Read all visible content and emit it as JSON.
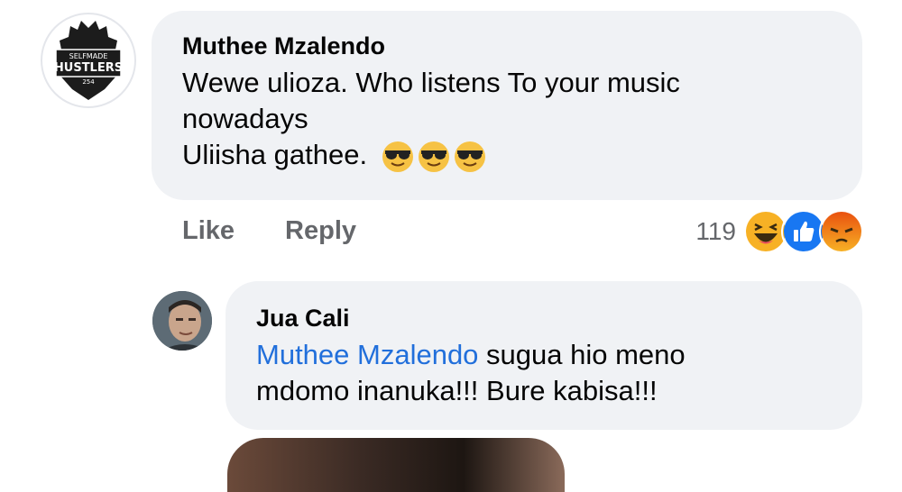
{
  "comment": {
    "author": "Muthee Mzalendo",
    "line1": "Wewe ulioza. Who listens To your music",
    "line2": "nowadays",
    "line3": "Uliisha gathee.",
    "emojis": [
      "sunglasses-face-icon",
      "sunglasses-face-icon",
      "sunglasses-face-icon"
    ],
    "avatar_logo_text": [
      "SELFMADE",
      "HUSTLERS",
      "254"
    ]
  },
  "actions": {
    "like": "Like",
    "reply": "Reply"
  },
  "reactions": {
    "count": "119",
    "icons": [
      "haha-reaction-icon",
      "like-reaction-icon",
      "angry-reaction-icon"
    ],
    "colors": {
      "like": "#1877f2",
      "haha": "#f7b125",
      "angry": "#e9710f"
    }
  },
  "reply": {
    "author": "Jua Cali",
    "mention": "Muthee Mzalendo",
    "text_after_mention": " sugua hio meno",
    "line2": "mdomo inanuka!!! Bure kabisa!!!"
  },
  "colors": {
    "bubble": "#f0f2f5",
    "mention": "#216fdb",
    "secondary_text": "#65676b"
  }
}
